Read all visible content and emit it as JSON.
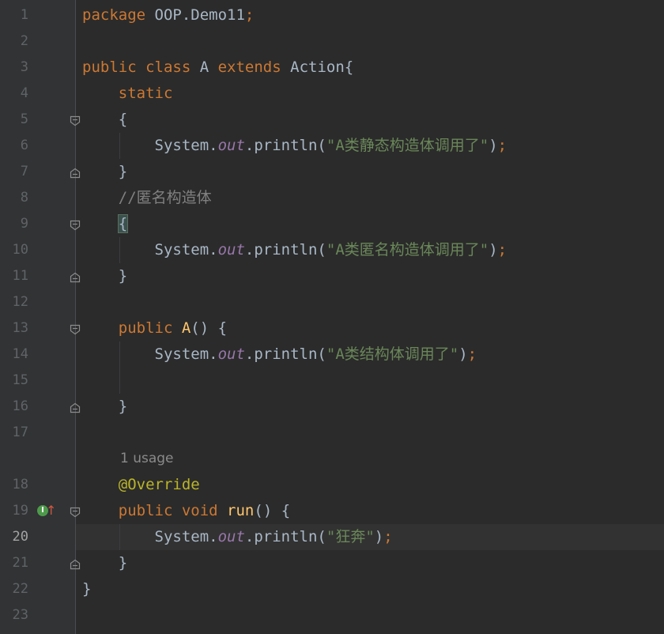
{
  "editor": {
    "current_line": 20,
    "lines": [
      {
        "n": "1",
        "tokens": [
          {
            "t": "package ",
            "c": "kw"
          },
          {
            "t": "OOP.Demo11",
            "c": ""
          },
          {
            "t": ";",
            "c": "kw"
          }
        ]
      },
      {
        "n": "2",
        "tokens": []
      },
      {
        "n": "3",
        "tokens": [
          {
            "t": "public ",
            "c": "kw"
          },
          {
            "t": "class ",
            "c": "kw"
          },
          {
            "t": "A ",
            "c": ""
          },
          {
            "t": "extends ",
            "c": "kw"
          },
          {
            "t": "Action{",
            "c": ""
          }
        ]
      },
      {
        "n": "4",
        "tokens": [
          {
            "t": "    ",
            "c": ""
          },
          {
            "t": "static",
            "c": "kw"
          }
        ]
      },
      {
        "n": "5",
        "tokens": [
          {
            "t": "    {",
            "c": ""
          }
        ]
      },
      {
        "n": "6",
        "tokens": [
          {
            "t": "        System.",
            "c": ""
          },
          {
            "t": "out",
            "c": "fld"
          },
          {
            "t": ".println(",
            "c": ""
          },
          {
            "t": "\"A类静态构造体调用了\"",
            "c": "str"
          },
          {
            "t": ")",
            "c": ""
          },
          {
            "t": ";",
            "c": "kw"
          }
        ]
      },
      {
        "n": "7",
        "tokens": [
          {
            "t": "    }",
            "c": ""
          }
        ]
      },
      {
        "n": "8",
        "tokens": [
          {
            "t": "    ",
            "c": ""
          },
          {
            "t": "//匿名构造体",
            "c": "cmt"
          }
        ]
      },
      {
        "n": "9",
        "tokens": [
          {
            "t": "    ",
            "c": ""
          },
          {
            "t": "{",
            "c": "brace-hl"
          }
        ]
      },
      {
        "n": "10",
        "tokens": [
          {
            "t": "        System.",
            "c": ""
          },
          {
            "t": "out",
            "c": "fld"
          },
          {
            "t": ".println(",
            "c": ""
          },
          {
            "t": "\"A类匿名构造体调用了\"",
            "c": "str"
          },
          {
            "t": ")",
            "c": ""
          },
          {
            "t": ";",
            "c": "kw"
          }
        ]
      },
      {
        "n": "11",
        "tokens": [
          {
            "t": "    }",
            "c": ""
          }
        ]
      },
      {
        "n": "12",
        "tokens": []
      },
      {
        "n": "13",
        "tokens": [
          {
            "t": "    ",
            "c": ""
          },
          {
            "t": "public ",
            "c": "kw"
          },
          {
            "t": "A",
            "c": "fn"
          },
          {
            "t": "() {",
            "c": ""
          }
        ]
      },
      {
        "n": "14",
        "tokens": [
          {
            "t": "        System.",
            "c": ""
          },
          {
            "t": "out",
            "c": "fld"
          },
          {
            "t": ".println(",
            "c": ""
          },
          {
            "t": "\"A类结构体调用了\"",
            "c": "str"
          },
          {
            "t": ")",
            "c": ""
          },
          {
            "t": ";",
            "c": "kw"
          }
        ]
      },
      {
        "n": "15",
        "tokens": []
      },
      {
        "n": "16",
        "tokens": [
          {
            "t": "    }",
            "c": ""
          }
        ]
      },
      {
        "n": "17",
        "tokens": []
      },
      {
        "n": "",
        "usage": "1 usage",
        "tokens": []
      },
      {
        "n": "18",
        "tokens": [
          {
            "t": "    ",
            "c": ""
          },
          {
            "t": "@Override",
            "c": "ann"
          }
        ]
      },
      {
        "n": "19",
        "tokens": [
          {
            "t": "    ",
            "c": ""
          },
          {
            "t": "public ",
            "c": "kw"
          },
          {
            "t": "void ",
            "c": "kw"
          },
          {
            "t": "run",
            "c": "fn"
          },
          {
            "t": "() {",
            "c": ""
          }
        ]
      },
      {
        "n": "20",
        "tokens": [
          {
            "t": "        System.",
            "c": ""
          },
          {
            "t": "out",
            "c": "fld"
          },
          {
            "t": ".println(",
            "c": ""
          },
          {
            "t": "\"狂奔\"",
            "c": "str"
          },
          {
            "t": ")",
            "c": ""
          },
          {
            "t": ";",
            "c": "kw"
          }
        ]
      },
      {
        "n": "21",
        "tokens": [
          {
            "t": "    }",
            "c": ""
          }
        ]
      },
      {
        "n": "22",
        "tokens": [
          {
            "t": "}",
            "c": ""
          }
        ]
      },
      {
        "n": "23",
        "tokens": []
      }
    ],
    "fold_open_lines": [
      "5",
      "9",
      "13",
      "19"
    ],
    "fold_close_lines": [
      "7",
      "11",
      "16",
      "21"
    ],
    "gutter_markers": [
      {
        "line": "19",
        "icons": [
          "implements-icon",
          "override-up-arrow-icon"
        ],
        "implements_glyph": "I",
        "arrow_glyph": "↑"
      }
    ]
  },
  "colors": {
    "background": "#2b2b2b",
    "gutter": "#313335",
    "keyword": "#cc7832",
    "string": "#6a8759",
    "field": "#9876aa",
    "method": "#ffc66d",
    "annotation": "#bbb529",
    "comment": "#808080",
    "text": "#a9b7c6"
  }
}
